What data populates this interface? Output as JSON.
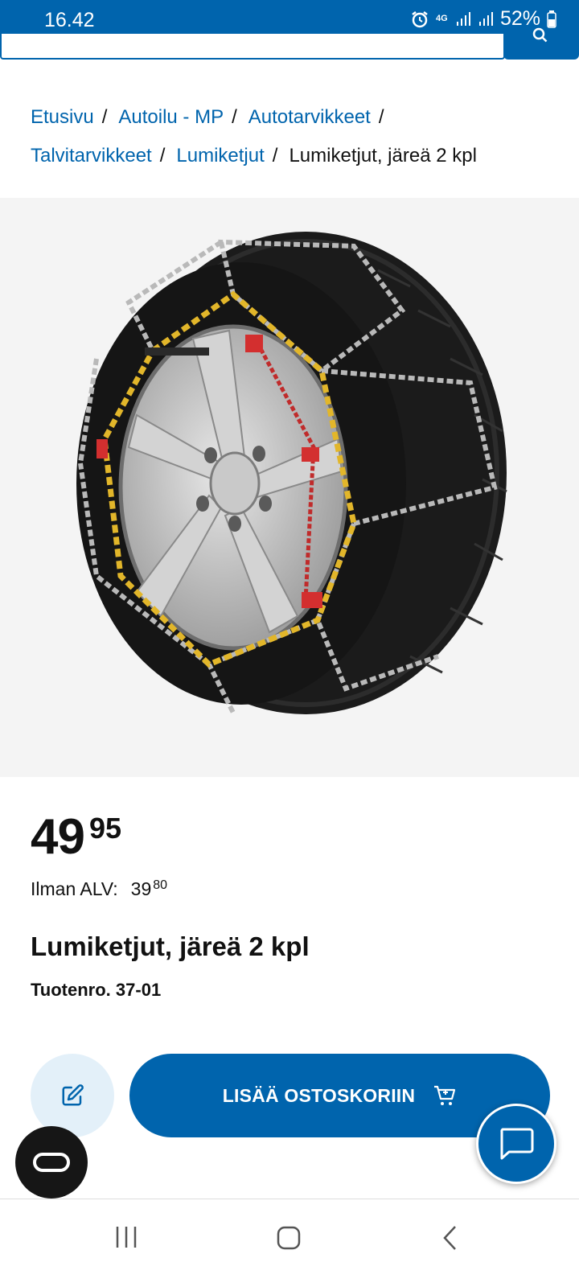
{
  "status_bar": {
    "time": "16.42",
    "network": "4G",
    "battery": "52%"
  },
  "breadcrumb": {
    "items": [
      "Etusivu",
      "Autoilu - MP",
      "Autotarvikkeet",
      "Talvitarvikkeet",
      "Lumiketjut"
    ],
    "separator": "/",
    "current": "Lumiketjut, järeä 2 kpl"
  },
  "product": {
    "image_icon": "snow-chain-tire-image",
    "price_int": "49",
    "price_dec": "95",
    "vat_label": "Ilman ALV:",
    "vat_int": "39",
    "vat_dec": "80",
    "title": "Lumiketjut, järeä 2 kpl",
    "sku": "Tuotenro. 37-01"
  },
  "actions": {
    "add_to_cart": "LISÄÄ OSTOSKORIIN"
  },
  "colors": {
    "brand_blue": "#0064ad",
    "light_blue": "#e3f0f9",
    "dark": "#161616"
  }
}
